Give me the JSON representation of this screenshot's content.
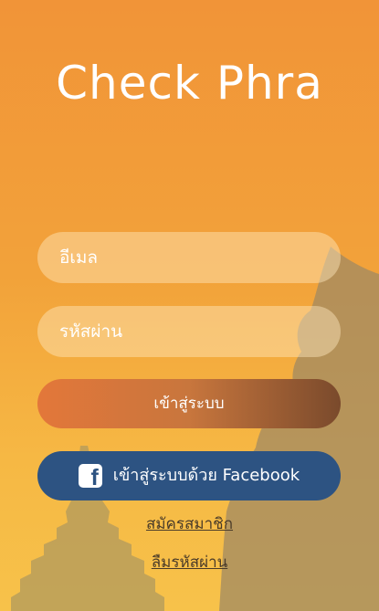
{
  "app": {
    "title": "Check Phra"
  },
  "login_form": {
    "email_placeholder": "อีเมล",
    "password_placeholder": "รหัสผ่าน",
    "login_button": "เข้าสู่ระบบ",
    "facebook_button": "เข้าสู่ระบบด้วย Facebook",
    "facebook_icon_glyph": "f",
    "register_link": "สมัครสมาชิก",
    "forgot_password_link": "ลืมรหัสผ่าน"
  },
  "icons": {
    "facebook": "facebook-icon",
    "buddha_silhouette": "buddha-silhouette",
    "stupa_silhouette": "stupa-silhouette"
  },
  "colors": {
    "background_top": "#f19438",
    "background_bottom": "#f7c24a",
    "facebook_blue": "#2d5382",
    "login_gradient_start": "#e3773a",
    "login_gradient_end": "#7a4a2c",
    "link_text": "#4a3b29"
  }
}
